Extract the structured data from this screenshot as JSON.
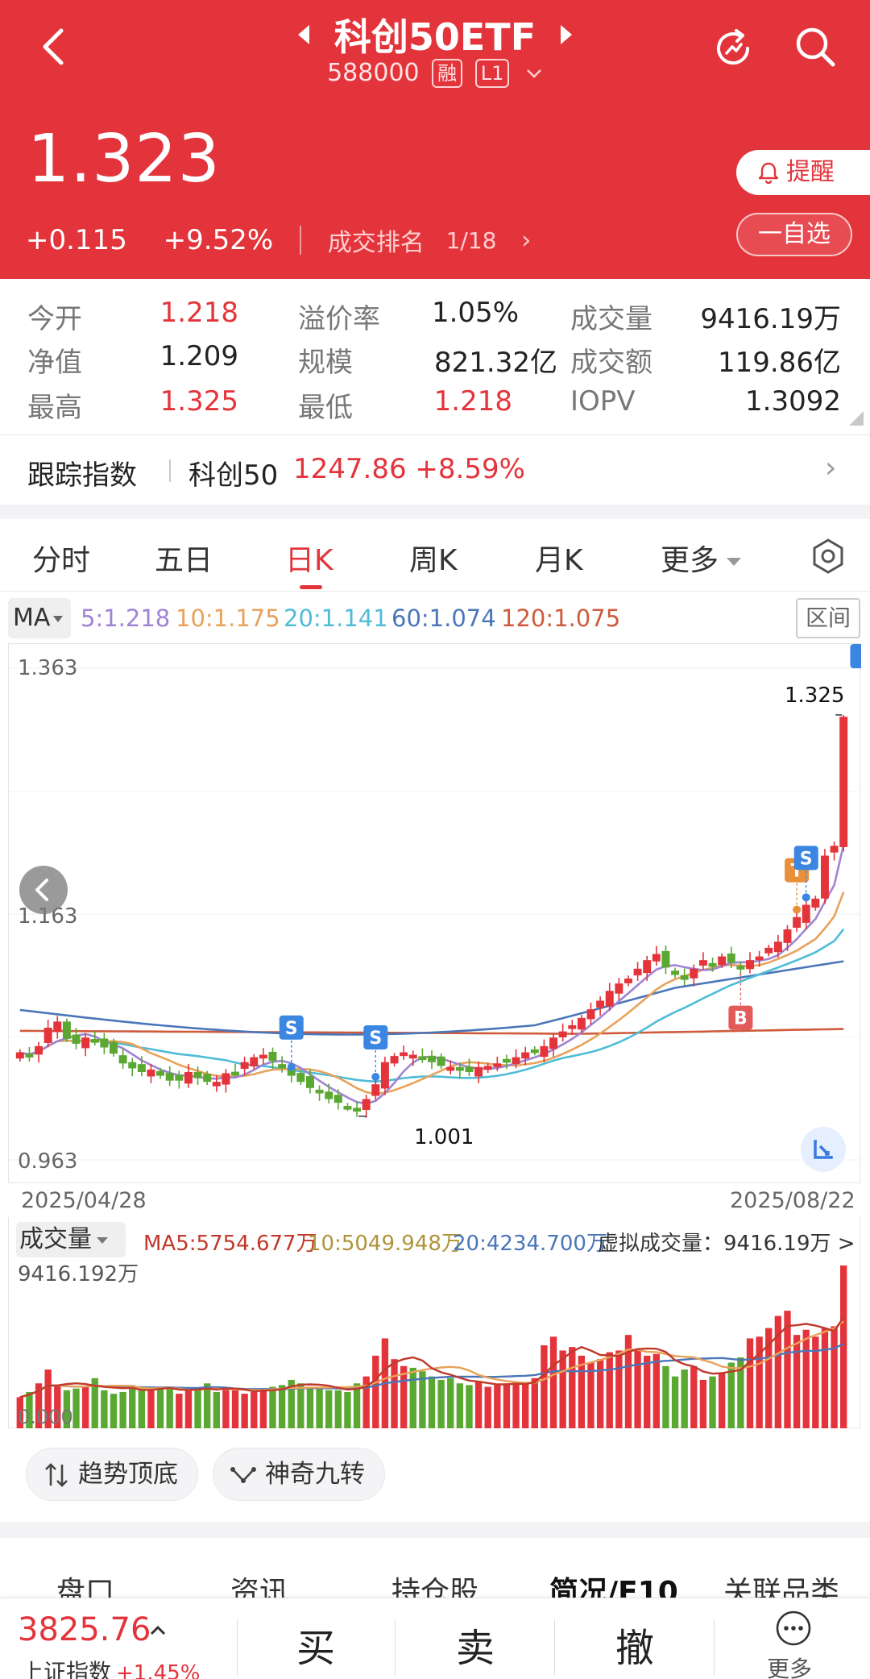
{
  "header": {
    "title": "科创50ETF",
    "code": "588000",
    "badge_margin": "融",
    "badge_level": "L1",
    "price": "1.323",
    "change": "+0.115",
    "change_pct": "+9.52%",
    "rank_label": "成交排名",
    "rank_value": "1/18",
    "alert_label": "提醒",
    "watch_label": "一自选",
    "bg_color": "#e4343b"
  },
  "stats": [
    {
      "label": "今开",
      "value": "1.218",
      "color": "red"
    },
    {
      "label": "溢价率",
      "value": "1.05%",
      "color": "normal"
    },
    {
      "label": "成交量",
      "value": "9416.19万",
      "color": "normal"
    },
    {
      "label": "净值",
      "value": "1.209",
      "color": "normal"
    },
    {
      "label": "规模",
      "value": "821.32亿",
      "color": "normal"
    },
    {
      "label": "成交额",
      "value": "119.86亿",
      "color": "normal"
    },
    {
      "label": "最高",
      "value": "1.325",
      "color": "red"
    },
    {
      "label": "最低",
      "value": "1.218",
      "color": "red"
    },
    {
      "label": "IOPV",
      "value": "1.3092",
      "color": "normal"
    }
  ],
  "tracking": {
    "label": "跟踪指数",
    "name": "科创50",
    "value": "1247.86 +8.59%"
  },
  "period_tabs": [
    "分时",
    "五日",
    "日K",
    "周K",
    "月K",
    "更多"
  ],
  "active_period": "日K",
  "ma": {
    "selector": "MA",
    "items": [
      {
        "text": "5:1.218",
        "color": "#a084d4"
      },
      {
        "text": "10:1.175",
        "color": "#e8a25a"
      },
      {
        "text": "20:1.141",
        "color": "#4fbcd8"
      },
      {
        "text": "60:1.074",
        "color": "#4a76b8"
      },
      {
        "text": "120:1.075",
        "color": "#cf5a3c"
      }
    ],
    "range_label": "区间"
  },
  "chart_data": {
    "type": "candlestick",
    "y_axis_labels": [
      "1.363",
      "1.163",
      "0.963"
    ],
    "ylim": [
      0.963,
      1.363
    ],
    "x_start": "2025/04/28",
    "x_end": "2025/08/22",
    "max_label": "1.325",
    "min_label": "1.001",
    "up_color": "#e4343b",
    "down_color": "#5aa832",
    "closes": [
      1.05,
      1.048,
      1.055,
      1.07,
      1.075,
      1.062,
      1.058,
      1.062,
      1.06,
      1.055,
      1.05,
      1.042,
      1.038,
      1.035,
      1.036,
      1.032,
      1.028,
      1.028,
      1.034,
      1.03,
      1.027,
      1.026,
      1.033,
      1.034,
      1.042,
      1.046,
      1.048,
      1.044,
      1.038,
      1.032,
      1.027,
      1.022,
      1.018,
      1.013,
      1.01,
      1.006,
      1.003,
      1.012,
      1.024,
      1.042,
      1.047,
      1.05,
      1.048,
      1.046,
      1.043,
      1.04,
      1.038,
      1.036,
      1.035,
      1.038,
      1.039,
      1.041,
      1.044,
      1.046,
      1.05,
      1.051,
      1.055,
      1.062,
      1.067,
      1.072,
      1.078,
      1.085,
      1.092,
      1.1,
      1.106,
      1.11,
      1.118,
      1.125,
      1.13,
      1.12,
      1.114,
      1.11,
      1.118,
      1.125,
      1.122,
      1.128,
      1.124,
      1.12,
      1.125,
      1.128,
      1.135,
      1.14,
      1.15,
      1.16,
      1.17,
      1.175,
      1.21,
      1.218,
      1.323
    ],
    "markers": {
      "sell": [
        29,
        38,
        84,
        90,
        91,
        95
      ],
      "buy": [
        77
      ],
      "alt": [
        83
      ]
    }
  },
  "volume": {
    "selector": "成交量",
    "ma5": "MA5:5754.677万",
    "ma10": "10:5049.948万",
    "ma20": "20:4234.700万",
    "virtual": "虚拟成交量：9416.19万 >",
    "max_label": "9416.192万",
    "min_label": "0.000",
    "values": [
      1800,
      2100,
      2600,
      3400,
      2500,
      2200,
      2300,
      2400,
      2900,
      2200,
      2000,
      2100,
      2500,
      2300,
      2200,
      2300,
      2400,
      2000,
      2200,
      2300,
      2600,
      2100,
      2300,
      2200,
      2000,
      2100,
      2300,
      2400,
      2500,
      2800,
      2600,
      2400,
      2300,
      2200,
      2200,
      2100,
      2600,
      3000,
      4200,
      5200,
      4000,
      3600,
      3500,
      3300,
      3000,
      2800,
      2900,
      2600,
      2500,
      2700,
      2400,
      2500,
      2600,
      2700,
      2600,
      2900,
      4800,
      5300,
      4500,
      4700,
      4200,
      3800,
      4000,
      4400,
      4500,
      5400,
      4600,
      4200,
      4300,
      3600,
      3000,
      3400,
      3600,
      2800,
      3000,
      3200,
      3800,
      4100,
      5200,
      5300,
      5800,
      6500,
      6800,
      5400,
      5700,
      5300,
      5800,
      5900,
      9416
    ]
  },
  "chips": [
    {
      "label": "趋势顶底",
      "icon": "trend-arrows-icon"
    },
    {
      "label": "神奇九转",
      "icon": "nine-turn-icon"
    }
  ],
  "info_tabs": [
    "盘口",
    "资讯",
    "持仓股",
    "简况/F10",
    "关联品类"
  ],
  "active_info_tab": "简况/F10",
  "bottom": {
    "index_value": "3825.76",
    "index_name": "上证指数",
    "index_change": "+1.45%",
    "buy": "买",
    "sell": "卖",
    "cancel": "撤",
    "more": "更多"
  }
}
